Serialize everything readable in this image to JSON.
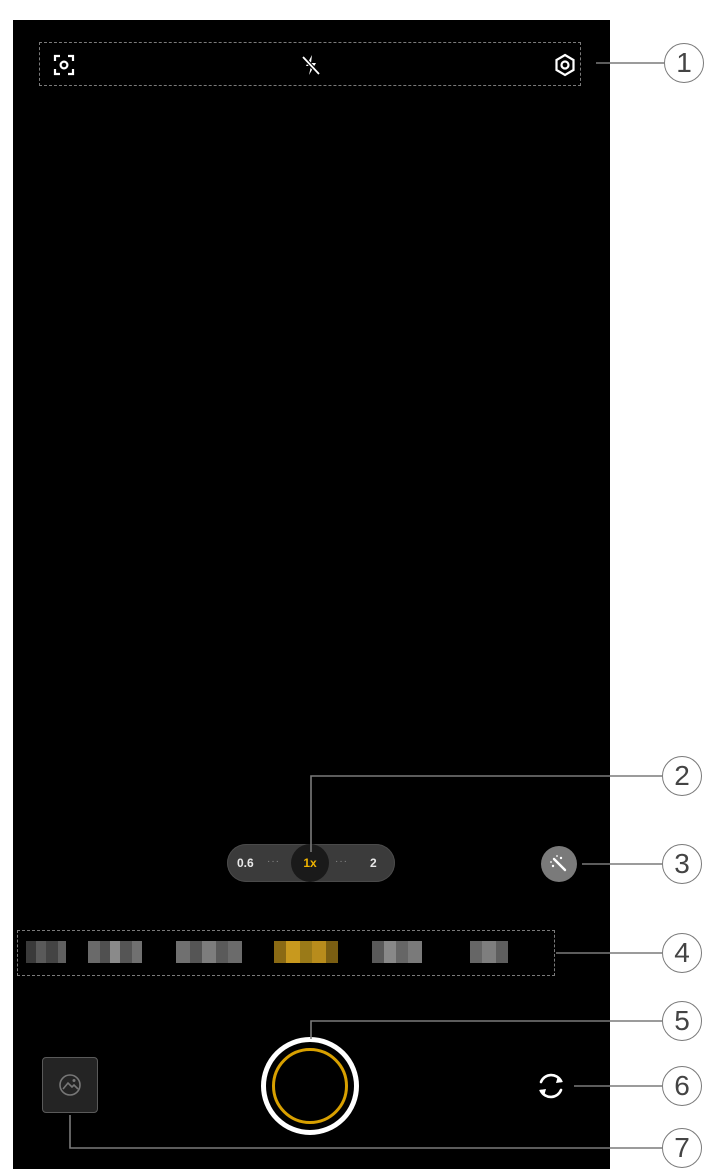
{
  "colors": {
    "viewfinder": "#000000",
    "accent_gold": "#d8a000",
    "zoom_active": "#f0b400",
    "callout_line": "#7a7a7a"
  },
  "topbar": {
    "icons": [
      "focus-scan-icon",
      "flash-off-icon",
      "settings-gear-icon"
    ]
  },
  "zoom": {
    "left": "0.6",
    "active": "1x",
    "right": "2",
    "dots": "···"
  },
  "beauty": {
    "icon": "magic-wand-icon"
  },
  "modes": {
    "count": 6,
    "selected_index": 3
  },
  "controls": {
    "gallery_icon": "gallery-thumbnail-icon",
    "shutter_icon": "shutter-icon",
    "switch_icon": "camera-switch-icon"
  },
  "callouts": [
    "1",
    "2",
    "3",
    "4",
    "5",
    "6",
    "7"
  ]
}
